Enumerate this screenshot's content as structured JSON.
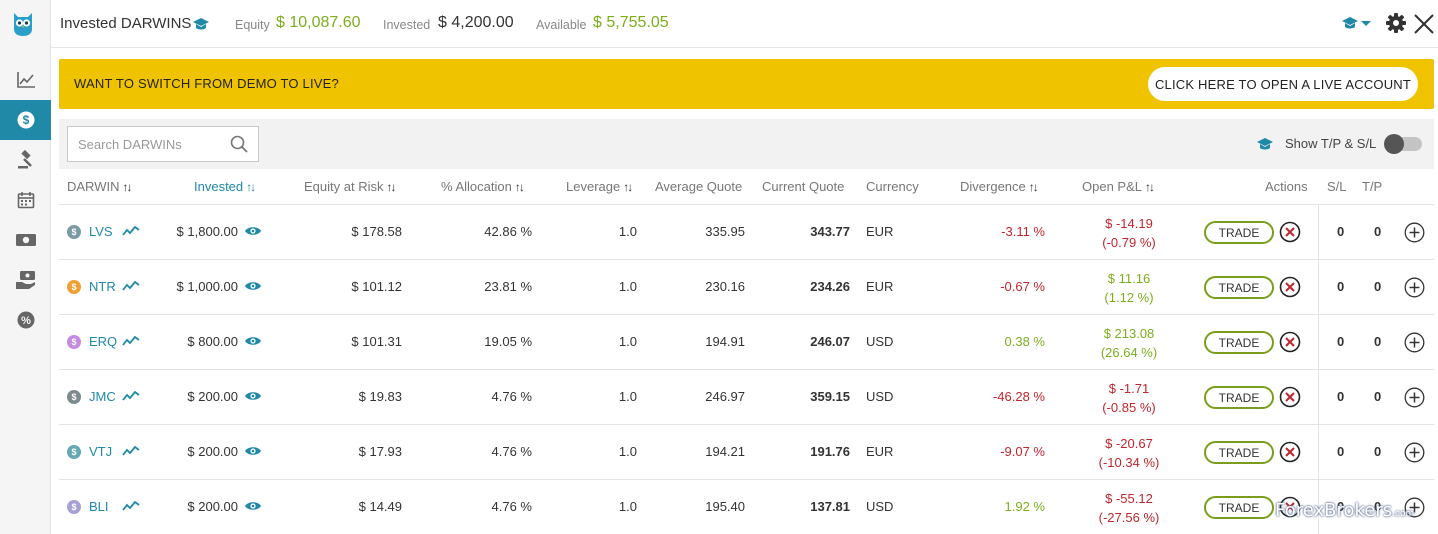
{
  "header": {
    "title": "Invested DARWINS",
    "equity_label": "Equity",
    "equity_value": "$ 10,087.60",
    "invested_label": "Invested",
    "invested_value": "$ 4,200.00",
    "available_label": "Available",
    "available_value": "$ 5,755.05"
  },
  "banner": {
    "text": "WANT TO SWITCH FROM DEMO TO LIVE?",
    "button": "CLICK HERE TO OPEN A LIVE ACCOUNT"
  },
  "toolbar": {
    "search_placeholder": "Search DARWINs",
    "tpsl_label": "Show T/P & S/L",
    "tpsl_on": false
  },
  "columns": {
    "darwin": "DARWIN",
    "invested": "Invested",
    "equity_at_risk": "Equity at Risk",
    "allocation": "% Allocation",
    "leverage": "Leverage",
    "average_quote": "Average Quote",
    "current_quote": "Current Quote",
    "currency": "Currency",
    "divergence": "Divergence",
    "open_pnl": "Open P&L",
    "actions": "Actions",
    "sl": "S/L",
    "tp": "T/P"
  },
  "trade_label": "TRADE",
  "rows": [
    {
      "name": "LVS",
      "coin_color": "#7c9aa3",
      "invested": "$ 1,800.00",
      "risk": "$ 178.58",
      "alloc": "42.86 %",
      "lev": "1.0",
      "avg": "335.95",
      "cur": "343.77",
      "ccy": "EUR",
      "div": "-3.11 %",
      "div_color": "#c0262d",
      "pnl1": "$ -14.19",
      "pnl2": "(-0.79 %)",
      "pnl_color": "#c0262d",
      "sl": "0",
      "tp": "0"
    },
    {
      "name": "NTR",
      "coin_color": "#f0a033",
      "invested": "$ 1,000.00",
      "risk": "$ 101.12",
      "alloc": "23.81 %",
      "lev": "1.0",
      "avg": "230.16",
      "cur": "234.26",
      "ccy": "EUR",
      "div": "-0.67 %",
      "div_color": "#c0262d",
      "pnl1": "$ 11.16",
      "pnl2": "(1.12 %)",
      "pnl_color": "#7cad1d",
      "sl": "0",
      "tp": "0"
    },
    {
      "name": "ERQ",
      "coin_color": "#c58be0",
      "invested": "$ 800.00",
      "risk": "$ 101.31",
      "alloc": "19.05 %",
      "lev": "1.0",
      "avg": "194.91",
      "cur": "246.07",
      "ccy": "USD",
      "div": "0.38 %",
      "div_color": "#7cad1d",
      "pnl1": "$ 213.08",
      "pnl2": "(26.64 %)",
      "pnl_color": "#7cad1d",
      "sl": "0",
      "tp": "0"
    },
    {
      "name": "JMC",
      "coin_color": "#7d8a8f",
      "invested": "$ 200.00",
      "risk": "$ 19.83",
      "alloc": "4.76 %",
      "lev": "1.0",
      "avg": "246.97",
      "cur": "359.15",
      "ccy": "USD",
      "div": "-46.28 %",
      "div_color": "#c0262d",
      "pnl1": "$ -1.71",
      "pnl2": "(-0.85 %)",
      "pnl_color": "#c0262d",
      "sl": "0",
      "tp": "0"
    },
    {
      "name": "VTJ",
      "coin_color": "#66a9b5",
      "invested": "$ 200.00",
      "risk": "$ 17.93",
      "alloc": "4.76 %",
      "lev": "1.0",
      "avg": "194.21",
      "cur": "191.76",
      "ccy": "EUR",
      "div": "-9.07 %",
      "div_color": "#c0262d",
      "pnl1": "$ -20.67",
      "pnl2": "(-10.34 %)",
      "pnl_color": "#c0262d",
      "sl": "0",
      "tp": "0"
    },
    {
      "name": "BLI",
      "coin_color": "#a6a0d6",
      "invested": "$ 200.00",
      "risk": "$ 14.49",
      "alloc": "4.76 %",
      "lev": "1.0",
      "avg": "195.40",
      "cur": "137.81",
      "ccy": "USD",
      "div": "1.92 %",
      "div_color": "#7cad1d",
      "pnl1": "$ -55.12",
      "pnl2": "(-27.56 %)",
      "pnl_color": "#c0262d",
      "sl": "0",
      "tp": "0"
    }
  ],
  "sidebar": {
    "items": [
      {
        "icon": "line-chart-icon",
        "active": false
      },
      {
        "icon": "dollar-icon",
        "active": true
      },
      {
        "icon": "gavel-icon",
        "active": false
      },
      {
        "icon": "calendar-icon",
        "active": false
      },
      {
        "icon": "banknote-icon",
        "active": false
      },
      {
        "icon": "hand-money-icon",
        "active": false
      },
      {
        "icon": "percent-icon",
        "active": false
      }
    ]
  },
  "watermark": {
    "text": "ForexBrokers",
    "suffix": ".com"
  }
}
